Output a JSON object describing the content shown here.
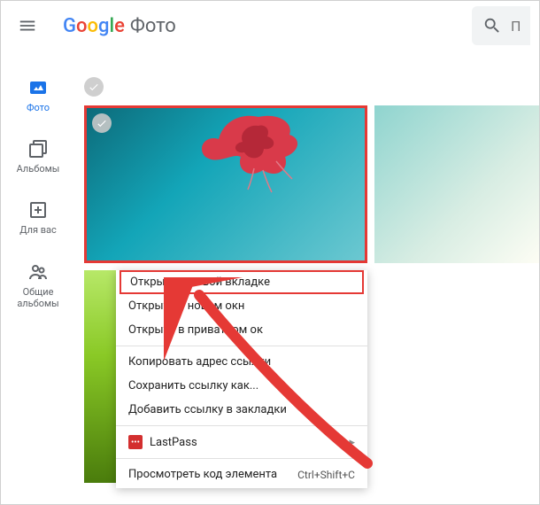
{
  "header": {
    "product": "Фото",
    "search_placeholder": "П"
  },
  "sidebar": {
    "photos": "Фото",
    "albums": "Альбомы",
    "foryou": "Для вас",
    "shared_l1": "Общие",
    "shared_l2": "альбомы"
  },
  "contextMenu": {
    "open_new_tab": "Открыть в новой вкладке",
    "open_new_window": "Открыть в новом окн",
    "open_private": "Открыть в приватном ок",
    "copy_link": "Копировать адрес ссылки",
    "save_link": "Сохранить ссылку как...",
    "bookmark_link": "Добавить ссылку в закладки",
    "lastpass": "LastPass",
    "inspect": "Просмотреть код элемента",
    "inspect_shortcut": "Ctrl+Shift+C"
  },
  "colors": {
    "highlight": "#e53935",
    "google_blue": "#4285F4",
    "google_red": "#EA4335",
    "google_yellow": "#FBBC05",
    "google_green": "#34A853",
    "accent_blue": "#1a73e8"
  }
}
